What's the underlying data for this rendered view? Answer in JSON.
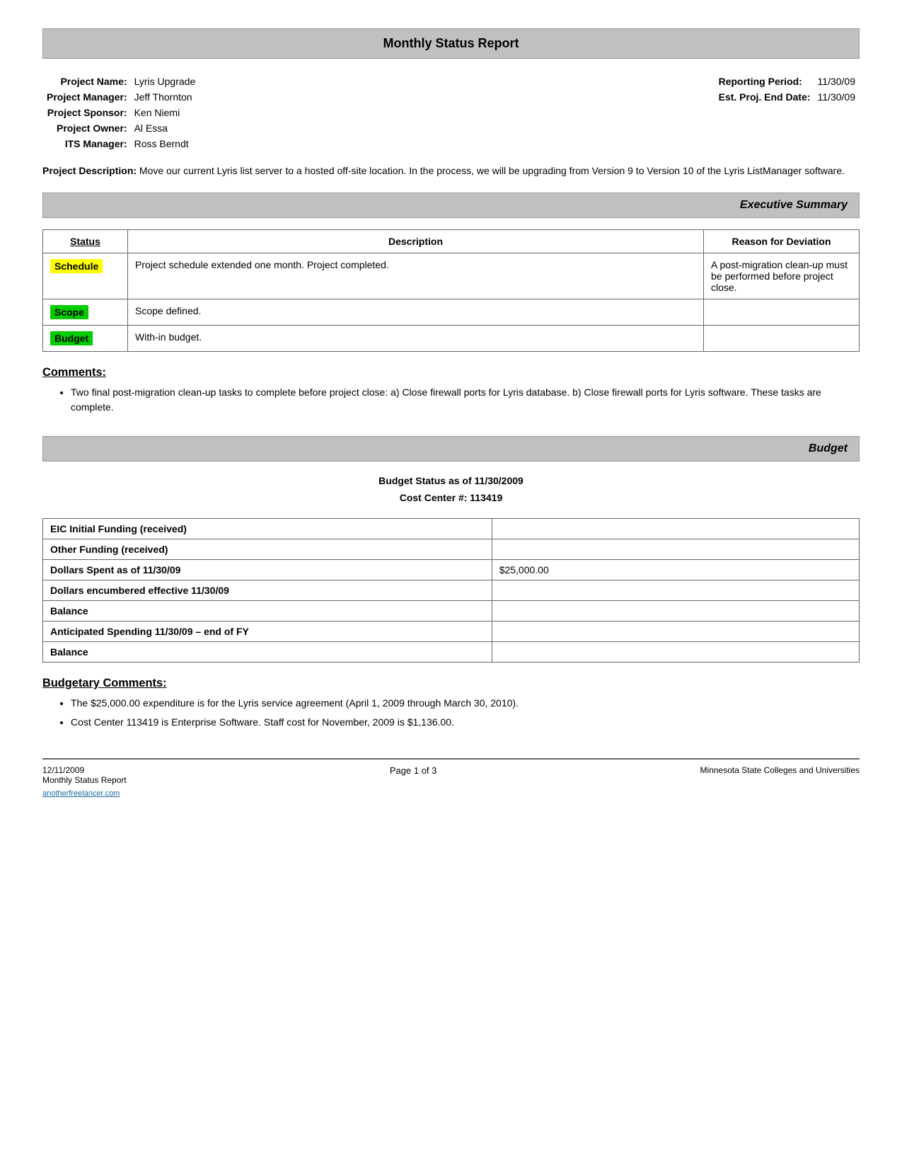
{
  "page": {
    "title": "Monthly Status Report",
    "project": {
      "name_label": "Project Name:",
      "name_value": "Lyris Upgrade",
      "manager_label": "Project Manager:",
      "manager_value": "Jeff Thornton",
      "sponsor_label": "Project Sponsor:",
      "sponsor_value": "Ken Niemi",
      "owner_label": "Project Owner:",
      "owner_value": "Al Essa",
      "its_manager_label": "ITS Manager:",
      "its_manager_value": "Ross Berndt",
      "reporting_period_label": "Reporting Period:",
      "reporting_period_value": "11/30/09",
      "est_end_date_label": "Est. Proj. End Date:",
      "est_end_date_value": "11/30/09"
    },
    "description_label": "Project Description:",
    "description_text": "Move our current Lyris list server to a hosted off-site location.  In the process, we will be upgrading from Version 9 to Version 10 of the Lyris ListManager software.",
    "executive_summary": {
      "section_title": "Executive Summary",
      "table_headers": [
        "Status",
        "Description",
        "Reason for Deviation"
      ],
      "rows": [
        {
          "status": "Schedule",
          "status_color": "yellow",
          "description": "Project schedule extended one month.  Project completed.",
          "reason": "A post-migration clean-up must be performed before project close."
        },
        {
          "status": "Scope",
          "status_color": "green",
          "description": "Scope defined.",
          "reason": ""
        },
        {
          "status": "Budget",
          "status_color": "green",
          "description": "With-in budget.",
          "reason": ""
        }
      ]
    },
    "comments": {
      "label": "Comments:",
      "items": [
        "Two final post-migration clean-up tasks to complete before project close:  a) Close firewall ports for Lyris database.  b) Close firewall ports for Lyris software.  These tasks are complete."
      ]
    },
    "budget_section": {
      "section_title": "Budget",
      "budget_status_line1": "Budget Status as of 11/30/2009",
      "budget_status_line2": "Cost Center #: 113419",
      "budget_rows": [
        {
          "label": "EIC Initial Funding (received)",
          "value": ""
        },
        {
          "label": "Other Funding (received)",
          "value": ""
        },
        {
          "label": "Dollars Spent as of 11/30/09",
          "value": "$25,000.00"
        },
        {
          "label": "Dollars encumbered effective 11/30/09",
          "value": ""
        },
        {
          "label": "Balance",
          "value": ""
        },
        {
          "label": "Anticipated Spending 11/30/09 – end of FY",
          "value": ""
        },
        {
          "label": "Balance",
          "value": ""
        }
      ]
    },
    "budgetary_comments": {
      "label": "Budgetary Comments:",
      "items": [
        "The $25,000.00 expenditure is for the Lyris service agreement (April 1, 2009 through March 30, 2010).",
        "Cost Center 113419 is Enterprise Software.  Staff cost for November, 2009 is $1,136.00."
      ]
    },
    "footer": {
      "date": "12/11/2009",
      "report_name": "Monthly Status Report",
      "page_info": "Page 1 of 3",
      "organization": "Minnesota State Colleges and Universities",
      "watermark": "anotherfreelancer.com"
    }
  }
}
